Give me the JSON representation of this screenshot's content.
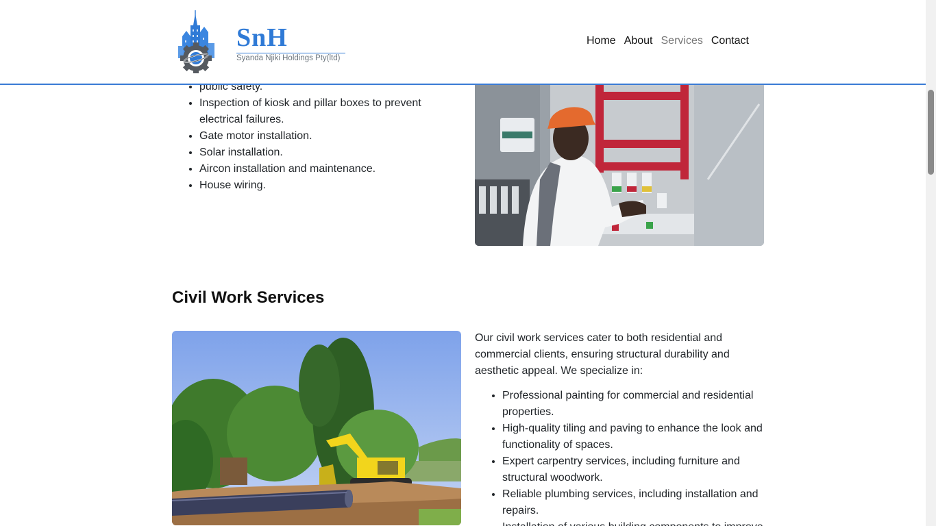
{
  "header": {
    "brand_title": "SnH",
    "brand_subtitle": "Syanda Njiki Holdings Pty(ltd)",
    "logo_icon": "city-gear-logo-icon",
    "nav": [
      {
        "label": "Home",
        "active": false
      },
      {
        "label": "About",
        "active": false
      },
      {
        "label": "Services",
        "active": true
      },
      {
        "label": "Contact",
        "active": false
      }
    ]
  },
  "electrical": {
    "items": [
      "public safety.",
      "Inspection of kiosk and pillar boxes to prevent electrical failures.",
      "Gate motor installation.",
      "Solar installation.",
      "Aircon installation and maintenance.",
      "House wiring."
    ],
    "image": "electrician-at-panel-photo"
  },
  "civil": {
    "title": "Civil Work Services",
    "intro": "Our civil work services cater to both residential and commercial clients, ensuring structural durability and aesthetic appeal. We specialize in:",
    "items": [
      "Professional painting for commercial and residential properties.",
      "High-quality tiling and paving to enhance the look and functionality of spaces.",
      "Expert carpentry services, including furniture and structural woodwork.",
      "Reliable plumbing services, including installation and repairs.",
      "Installation of various building components to improve"
    ],
    "image": "excavator-pipeline-photo"
  },
  "colors": {
    "brand": "#2f7ad6",
    "header_border": "#3a7bd5",
    "nav_active": "#777777"
  }
}
